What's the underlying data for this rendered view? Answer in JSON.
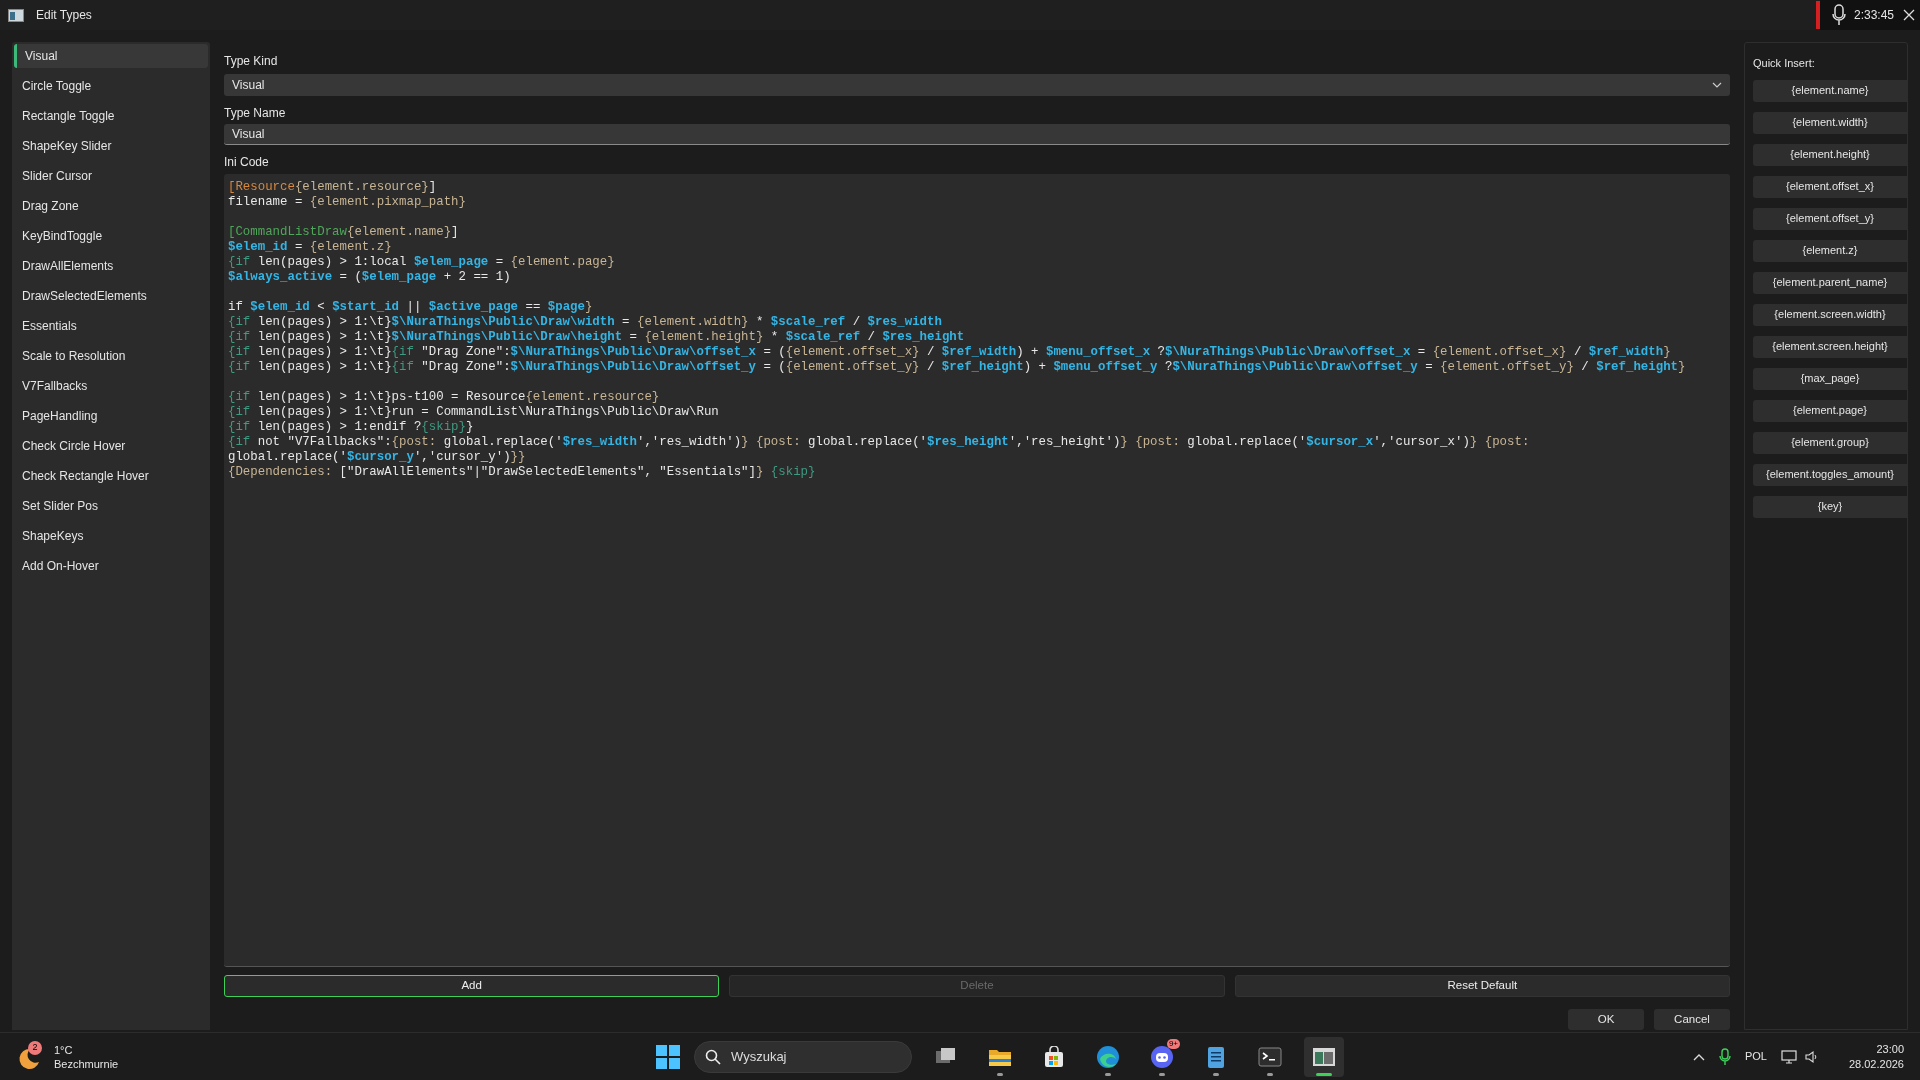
{
  "window": {
    "title": "Edit Types",
    "timer": "2:33:45"
  },
  "sidebar": {
    "items": [
      {
        "label": "Visual",
        "selected": true
      },
      {
        "label": "Circle Toggle",
        "selected": false
      },
      {
        "label": "Rectangle Toggle",
        "selected": false
      },
      {
        "label": "ShapeKey Slider",
        "selected": false
      },
      {
        "label": "Slider Cursor",
        "selected": false
      },
      {
        "label": "Drag Zone",
        "selected": false
      },
      {
        "label": "KeyBindToggle",
        "selected": false
      },
      {
        "label": "DrawAllElements",
        "selected": false
      },
      {
        "label": "DrawSelectedElements",
        "selected": false
      },
      {
        "label": "Essentials",
        "selected": false
      },
      {
        "label": "Scale to Resolution",
        "selected": false
      },
      {
        "label": "V7Fallbacks",
        "selected": false
      },
      {
        "label": "PageHandling",
        "selected": false
      },
      {
        "label": "Check Circle Hover",
        "selected": false
      },
      {
        "label": "Check Rectangle Hover",
        "selected": false
      },
      {
        "label": "Set Slider Pos",
        "selected": false
      },
      {
        "label": "ShapeKeys",
        "selected": false
      },
      {
        "label": "Add On-Hover",
        "selected": false
      }
    ]
  },
  "form": {
    "type_kind": {
      "label": "Type Kind",
      "value": "Visual"
    },
    "type_name": {
      "label": "Type Name",
      "value": "Visual"
    },
    "ini_code": {
      "label": "Ini Code",
      "lines": [
        {
          "kind": "code",
          "tokens": [
            {
              "kind": "section",
              "text": "[Resource"
            },
            {
              "kind": "template",
              "text": "{element.resource}"
            },
            {
              "kind": "plain",
              "text": "]"
            }
          ]
        },
        {
          "kind": "code",
          "tokens": [
            {
              "kind": "plain",
              "text": "filename = "
            },
            {
              "kind": "template",
              "text": "{element.pixmap_path}"
            }
          ]
        },
        {
          "kind": "blank"
        },
        {
          "kind": "code",
          "tokens": [
            {
              "kind": "section2",
              "text": "[CommandListDraw"
            },
            {
              "kind": "template",
              "text": "{element.name}"
            },
            {
              "kind": "plain",
              "text": "]"
            }
          ]
        },
        {
          "kind": "code",
          "tokens": [
            {
              "kind": "var",
              "text": "$elem_id"
            },
            {
              "kind": "plain",
              "text": " = "
            },
            {
              "kind": "template",
              "text": "{element.z}"
            }
          ]
        },
        {
          "kind": "code",
          "tokens": [
            {
              "kind": "cond",
              "text": "{if"
            },
            {
              "kind": "plain",
              "text": " len(pages) > 1:local "
            },
            {
              "kind": "var",
              "text": "$elem_page"
            },
            {
              "kind": "plain",
              "text": " = "
            },
            {
              "kind": "template",
              "text": "{element.page}"
            }
          ]
        },
        {
          "kind": "code",
          "tokens": [
            {
              "kind": "var",
              "text": "$always_active"
            },
            {
              "kind": "plain",
              "text": " = ("
            },
            {
              "kind": "var",
              "text": "$elem_page"
            },
            {
              "kind": "plain",
              "text": " + 2 == 1)"
            }
          ]
        },
        {
          "kind": "blank"
        },
        {
          "kind": "code",
          "tokens": [
            {
              "kind": "plain",
              "text": "if "
            },
            {
              "kind": "var",
              "text": "$elem_id"
            },
            {
              "kind": "plain",
              "text": " < "
            },
            {
              "kind": "var",
              "text": "$start_id"
            },
            {
              "kind": "plain",
              "text": " || "
            },
            {
              "kind": "var",
              "text": "$active_page"
            },
            {
              "kind": "plain",
              "text": " == "
            },
            {
              "kind": "var",
              "text": "$page"
            },
            {
              "kind": "template",
              "text": "}"
            }
          ]
        },
        {
          "kind": "code",
          "tokens": [
            {
              "kind": "cond",
              "text": "{if"
            },
            {
              "kind": "plain",
              "text": " len(pages) > 1:\\t}"
            },
            {
              "kind": "var",
              "text": "$\\NuraThings\\Public\\Draw\\width"
            },
            {
              "kind": "plain",
              "text": " = "
            },
            {
              "kind": "template",
              "text": "{element.width}"
            },
            {
              "kind": "plain",
              "text": " * "
            },
            {
              "kind": "var",
              "text": "$scale_ref"
            },
            {
              "kind": "plain",
              "text": " / "
            },
            {
              "kind": "var",
              "text": "$res_width"
            }
          ]
        },
        {
          "kind": "code",
          "tokens": [
            {
              "kind": "cond",
              "text": "{if"
            },
            {
              "kind": "plain",
              "text": " len(pages) > 1:\\t}"
            },
            {
              "kind": "var",
              "text": "$\\NuraThings\\Public\\Draw\\height"
            },
            {
              "kind": "plain",
              "text": " = "
            },
            {
              "kind": "template",
              "text": "{element.height}"
            },
            {
              "kind": "plain",
              "text": " * "
            },
            {
              "kind": "var",
              "text": "$scale_ref"
            },
            {
              "kind": "plain",
              "text": " / "
            },
            {
              "kind": "var",
              "text": "$res_height"
            }
          ]
        },
        {
          "kind": "code",
          "tokens": [
            {
              "kind": "cond",
              "text": "{if"
            },
            {
              "kind": "plain",
              "text": " len(pages) > 1:\\t}"
            },
            {
              "kind": "cond",
              "text": "{if"
            },
            {
              "kind": "plain",
              "text": " \"Drag Zone\":"
            },
            {
              "kind": "var",
              "text": "$\\NuraThings\\Public\\Draw\\offset_x"
            },
            {
              "kind": "plain",
              "text": " = ("
            },
            {
              "kind": "template",
              "text": "{element.offset_x}"
            },
            {
              "kind": "plain",
              "text": " / "
            },
            {
              "kind": "var",
              "text": "$ref_width"
            },
            {
              "kind": "plain",
              "text": ") + "
            },
            {
              "kind": "var",
              "text": "$menu_offset_x"
            },
            {
              "kind": "plain",
              "text": " ?"
            },
            {
              "kind": "var",
              "text": "$\\NuraThings\\Public\\Draw\\offset_x"
            },
            {
              "kind": "plain",
              "text": " = "
            },
            {
              "kind": "template",
              "text": "{element.offset_x}"
            },
            {
              "kind": "plain",
              "text": " / "
            },
            {
              "kind": "var",
              "text": "$ref_width"
            },
            {
              "kind": "template",
              "text": "}"
            }
          ]
        },
        {
          "kind": "code",
          "tokens": [
            {
              "kind": "cond",
              "text": "{if"
            },
            {
              "kind": "plain",
              "text": " len(pages) > 1:\\t}"
            },
            {
              "kind": "cond",
              "text": "{if"
            },
            {
              "kind": "plain",
              "text": " \"Drag Zone\":"
            },
            {
              "kind": "var",
              "text": "$\\NuraThings\\Public\\Draw\\offset_y"
            },
            {
              "kind": "plain",
              "text": " = ("
            },
            {
              "kind": "template",
              "text": "{element.offset_y}"
            },
            {
              "kind": "plain",
              "text": " / "
            },
            {
              "kind": "var",
              "text": "$ref_height"
            },
            {
              "kind": "plain",
              "text": ") + "
            },
            {
              "kind": "var",
              "text": "$menu_offset_y"
            },
            {
              "kind": "plain",
              "text": " ?"
            },
            {
              "kind": "var",
              "text": "$\\NuraThings\\Public\\Draw\\offset_y"
            },
            {
              "kind": "plain",
              "text": " = "
            },
            {
              "kind": "template",
              "text": "{element.offset_y}"
            },
            {
              "kind": "plain",
              "text": " / "
            },
            {
              "kind": "var",
              "text": "$ref_height"
            },
            {
              "kind": "template",
              "text": "}"
            }
          ]
        },
        {
          "kind": "blank"
        },
        {
          "kind": "code",
          "tokens": [
            {
              "kind": "cond",
              "text": "{if"
            },
            {
              "kind": "plain",
              "text": " len(pages) > 1:\\t}ps-t100 = Resource"
            },
            {
              "kind": "template",
              "text": "{element.resource}"
            }
          ]
        },
        {
          "kind": "code",
          "tokens": [
            {
              "kind": "cond",
              "text": "{if"
            },
            {
              "kind": "plain",
              "text": " len(pages) > 1:\\t}run = CommandList\\NuraThings\\Public\\Draw\\Run"
            }
          ]
        },
        {
          "kind": "code",
          "tokens": [
            {
              "kind": "cond",
              "text": "{if"
            },
            {
              "kind": "plain",
              "text": " len(pages) > 1:endif ?"
            },
            {
              "kind": "cond",
              "text": "{skip}"
            },
            {
              "kind": "plain",
              "text": "}"
            }
          ]
        },
        {
          "kind": "code",
          "tokens": [
            {
              "kind": "cond",
              "text": "{if"
            },
            {
              "kind": "plain",
              "text": " not \"V7Fallbacks\":"
            },
            {
              "kind": "template",
              "text": "{post:"
            },
            {
              "kind": "plain",
              "text": " global.replace('"
            },
            {
              "kind": "var",
              "text": "$res_width"
            },
            {
              "kind": "plain",
              "text": "','res_width')"
            },
            {
              "kind": "template",
              "text": "} {post:"
            },
            {
              "kind": "plain",
              "text": " global.replace('"
            },
            {
              "kind": "var",
              "text": "$res_height"
            },
            {
              "kind": "plain",
              "text": "','res_height')"
            },
            {
              "kind": "template",
              "text": "} {post:"
            },
            {
              "kind": "plain",
              "text": " global.replace('"
            },
            {
              "kind": "var",
              "text": "$cursor_x"
            },
            {
              "kind": "plain",
              "text": "','cursor_x')"
            },
            {
              "kind": "template",
              "text": "} {post:"
            }
          ]
        },
        {
          "kind": "code",
          "tokens": [
            {
              "kind": "plain",
              "text": "global.replace('"
            },
            {
              "kind": "var",
              "text": "$cursor_y"
            },
            {
              "kind": "plain",
              "text": "','cursor_y')"
            },
            {
              "kind": "template",
              "text": "}}"
            }
          ]
        },
        {
          "kind": "code",
          "tokens": [
            {
              "kind": "template",
              "text": "{Dependencies:"
            },
            {
              "kind": "plain",
              "text": " [\"DrawAllElements\"|\"DrawSelectedElements\", \"Essentials\"]"
            },
            {
              "kind": "template",
              "text": "}"
            },
            {
              "kind": "cond",
              "text": " {skip}"
            }
          ]
        }
      ]
    },
    "buttons": [
      {
        "label": "Add",
        "focused": true,
        "disabled": false
      },
      {
        "label": "Delete",
        "focused": false,
        "disabled": true
      },
      {
        "label": "Reset Default",
        "focused": false,
        "disabled": false
      }
    ]
  },
  "quick_insert": {
    "title": "Quick Insert:",
    "items": [
      "{element.name}",
      "{element.width}",
      "{element.height}",
      "{element.offset_x}",
      "{element.offset_y}",
      "{element.z}",
      "{element.parent_name}",
      "{element.screen.width}",
      "{element.screen.height}",
      "{max_page}",
      "{element.page}",
      "{element.group}",
      "{element.toggles_amount}",
      "{key}"
    ]
  },
  "dialog_buttons": [
    "OK",
    "Cancel"
  ],
  "taskbar": {
    "weather": {
      "badge": "2",
      "temperature": "1°C",
      "condition": "Bezchmurnie"
    },
    "search": {
      "placeholder": "Wyszukaj"
    },
    "apps": [
      {
        "kind": "taskview",
        "running": false,
        "active": false
      },
      {
        "kind": "folder",
        "running": true,
        "active": false
      },
      {
        "kind": "store",
        "running": false,
        "active": false
      },
      {
        "kind": "browser",
        "running": true,
        "active": false
      },
      {
        "kind": "chat",
        "running": true,
        "active": false,
        "badge": "9+"
      },
      {
        "kind": "notepad",
        "running": true,
        "active": false
      },
      {
        "kind": "terminal",
        "running": true,
        "active": false
      },
      {
        "kind": "app",
        "running": true,
        "active": true
      }
    ],
    "tray": {
      "language": "POL",
      "time": "23:00",
      "date": "28.02.2026"
    }
  }
}
